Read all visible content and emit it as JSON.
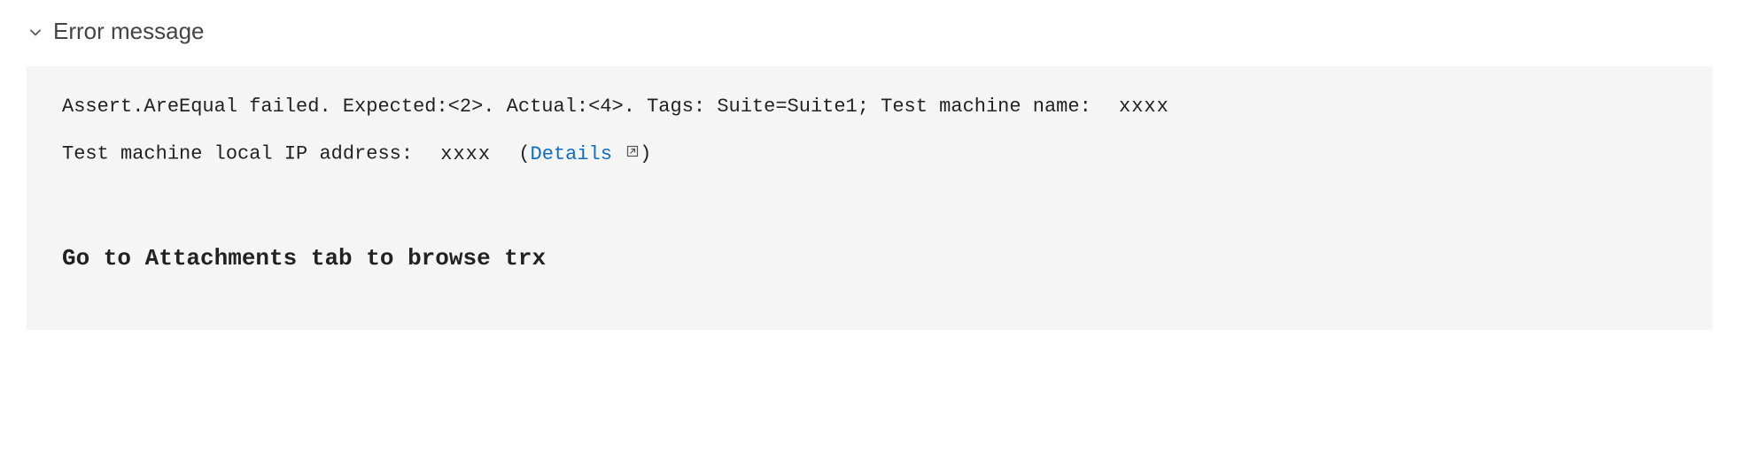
{
  "section": {
    "title": "Error message"
  },
  "error": {
    "line1_part1": "Assert.AreEqual failed. Expected:<2>. Actual:<4>. Tags: Suite=Suite1; Test machine name: ",
    "machine_name_masked": "xxxx",
    "line2_part1": "Test machine local IP address: ",
    "ip_masked": "xxxx",
    "paren_open": " (",
    "details_label": "Details",
    "paren_close": ")"
  },
  "cta": {
    "bold_message": "Go to Attachments tab to browse trx"
  }
}
